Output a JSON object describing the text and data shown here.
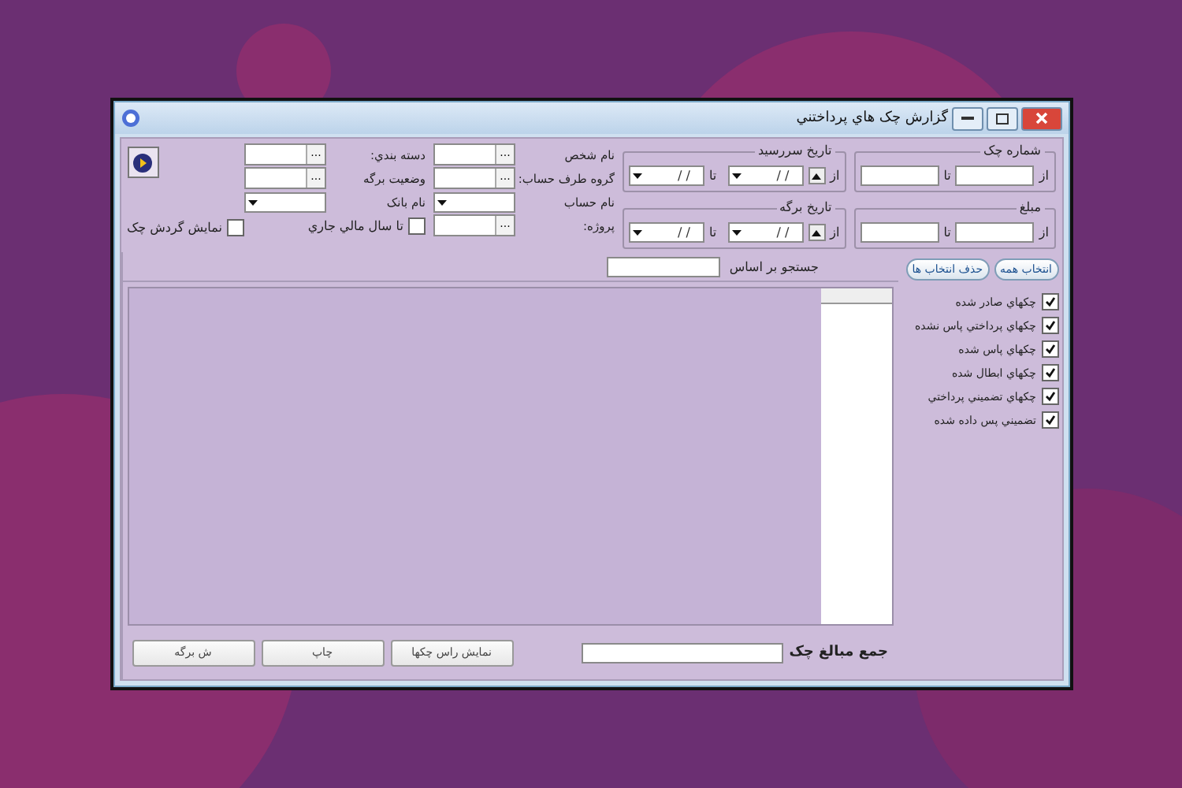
{
  "window": {
    "title": "گزارش چک هاي پرداختني"
  },
  "ranges": [
    {
      "label": "شماره چک",
      "from_label": "از",
      "to_label": "تا"
    },
    {
      "label": "مبلغ",
      "from_label": "از",
      "to_label": "تا"
    }
  ],
  "date_ranges": [
    {
      "label": "تاريخ سررسيد",
      "from_label": "از",
      "to_label": "تا",
      "from_value": "/  /",
      "to_value": "/  /"
    },
    {
      "label": "تاريخ برگه",
      "from_label": "از",
      "to_label": "تا",
      "from_value": "/  /",
      "to_value": "/  /"
    }
  ],
  "filters_1": [
    {
      "label": "نام شخص",
      "kind": "lookup",
      "button": "..."
    },
    {
      "label": "گروه طرف حساب:",
      "kind": "lookup",
      "button": "..."
    },
    {
      "label": "نام حساب",
      "kind": "dropdown"
    },
    {
      "label": "پروژه:",
      "kind": "lookup",
      "button": "..."
    }
  ],
  "filters_2": [
    {
      "label": "دسته بندي:",
      "kind": "lookup",
      "button": "..."
    },
    {
      "label": "وضعيت برگه",
      "kind": "lookup",
      "button": "..."
    },
    {
      "label": "نام بانک",
      "kind": "dropdown"
    },
    {
      "label": "تا سال مالي جاري",
      "kind": "checkbox",
      "checked": false
    }
  ],
  "show_cheque_flow": {
    "label": "نمايش گردش چک",
    "checked": false
  },
  "search": {
    "label": "جستجو بر اساس"
  },
  "select_buttons": [
    "انتخاب همه",
    "حذف انتخاب ها"
  ],
  "statuses": [
    {
      "label": "چکهاي صادر شده",
      "checked": true
    },
    {
      "label": "چکهاي پرداختي پاس نشده",
      "checked": true
    },
    {
      "label": "چکهاي پاس شده",
      "checked": true
    },
    {
      "label": "چکهاي ابطال شده",
      "checked": true
    },
    {
      "label": "چکهاي تضميني پرداختي",
      "checked": true
    },
    {
      "label": "تضميني پس داده شده",
      "checked": true
    }
  ],
  "total": {
    "label": "جمع مبالغ چک"
  },
  "buttons": [
    {
      "label": "نمايش راس چکها"
    },
    {
      "label": "چاپ"
    },
    {
      "label": "ش برگه"
    }
  ]
}
